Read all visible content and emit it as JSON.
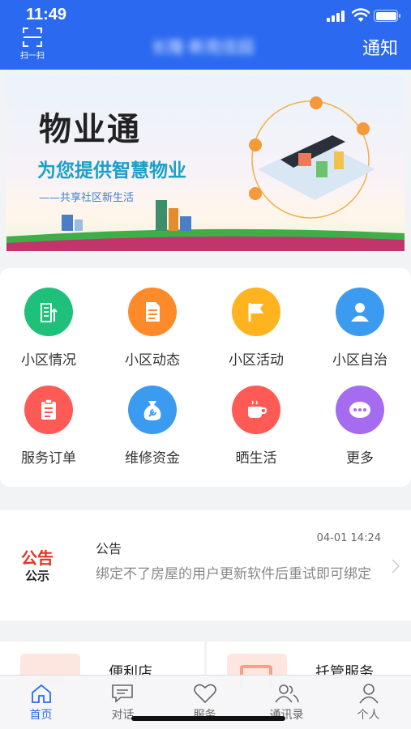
{
  "status_bar": {
    "time": "11:49"
  },
  "header": {
    "scan_label": "扫一扫",
    "title": "长隆·新苑佳园",
    "notify_label": "通知",
    "bg_color": "#2b6af0"
  },
  "banner": {
    "title": "物业通",
    "subtitle": "为您提供智慧物业",
    "tagline": "——共享社区新生活"
  },
  "grid": {
    "items": [
      {
        "label": "小区情况",
        "icon": "building-icon",
        "color": "#1fc07a"
      },
      {
        "label": "小区动态",
        "icon": "document-icon",
        "color": "#ff8a2a"
      },
      {
        "label": "小区活动",
        "icon": "flag-icon",
        "color": "#ffb31f"
      },
      {
        "label": "小区自治",
        "icon": "person-icon",
        "color": "#3a9bf0"
      },
      {
        "label": "服务订单",
        "icon": "clipboard-icon",
        "color": "#ff5a55"
      },
      {
        "label": "维修资金",
        "icon": "wrench-bag-icon",
        "color": "#3a9bf0"
      },
      {
        "label": "晒生活",
        "icon": "coffee-cup-icon",
        "color": "#ff5a55"
      },
      {
        "label": "更多",
        "icon": "more-dots-icon",
        "color": "#a56cf0"
      }
    ]
  },
  "notice": {
    "badge_top": "公告",
    "badge_bottom": "公示",
    "title": "公告",
    "time": "04-01 14:24",
    "body": "绑定不了房屋的用户更新软件后重试即可绑定"
  },
  "services": [
    {
      "name": "便利店"
    },
    {
      "name": "托管服务"
    }
  ],
  "tabbar": {
    "active_color": "#2b6af0",
    "tabs": [
      {
        "label": "首页",
        "icon": "home-icon",
        "active": true
      },
      {
        "label": "对话",
        "icon": "chat-icon",
        "active": false
      },
      {
        "label": "服务",
        "icon": "heart-icon",
        "active": false
      },
      {
        "label": "通讯录",
        "icon": "contacts-icon",
        "active": false
      },
      {
        "label": "个人",
        "icon": "user-icon",
        "active": false
      }
    ]
  }
}
